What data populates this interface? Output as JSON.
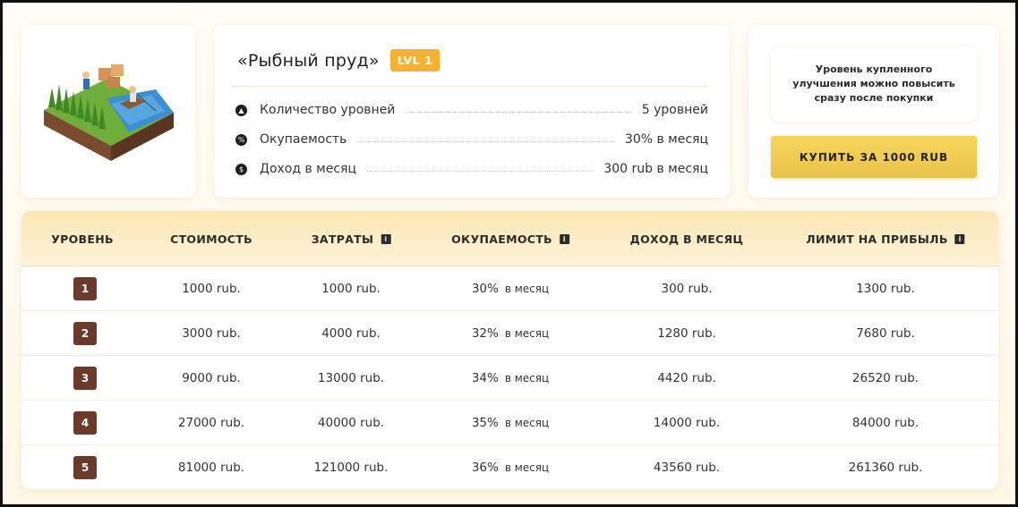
{
  "product": {
    "title": "«Рыбный пруд»",
    "level_badge": "LVL 1",
    "image_icon": "fishing-pond-isometric-icon"
  },
  "stats": [
    {
      "icon": "arrow-up-icon",
      "label": "Количество уровней",
      "value": "5 уровней"
    },
    {
      "icon": "percent-icon",
      "label": "Окупаемость",
      "value": "30% в месяц"
    },
    {
      "icon": "dollar-icon",
      "label": "Доход в месяц",
      "value": "300 rub в месяц"
    }
  ],
  "purchase": {
    "note": "Уровень купленного улучшения можно повысить сразу после покупки",
    "buy_label": "КУПИТЬ ЗА 1000 RUB"
  },
  "table": {
    "headers": [
      "УРОВЕНЬ",
      "СТОИМОСТЬ",
      "ЗАТРАТЫ",
      "ОКУПАЕМОСТЬ",
      "ДОХОД В МЕСЯЦ",
      "ЛИМИТ НА ПРИБЫЛЬ"
    ],
    "rows": [
      {
        "level": "1",
        "cost": "1000 rub.",
        "expenses": "1000 rub.",
        "payback": "30%",
        "payback_suffix": "в месяц",
        "income": "300 rub.",
        "limit": "1300 rub."
      },
      {
        "level": "2",
        "cost": "3000 rub.",
        "expenses": "4000 rub.",
        "payback": "32%",
        "payback_suffix": "в месяц",
        "income": "1280 rub.",
        "limit": "7680 rub."
      },
      {
        "level": "3",
        "cost": "9000 rub.",
        "expenses": "13000 rub.",
        "payback": "34%",
        "payback_suffix": "в месяц",
        "income": "4420 rub.",
        "limit": "26520 rub."
      },
      {
        "level": "4",
        "cost": "27000 rub.",
        "expenses": "40000 rub.",
        "payback": "35%",
        "payback_suffix": "в месяц",
        "income": "14000 rub.",
        "limit": "84000 rub."
      },
      {
        "level": "5",
        "cost": "81000 rub.",
        "expenses": "121000 rub.",
        "payback": "36%",
        "payback_suffix": "в месяц",
        "income": "43560 rub.",
        "limit": "261360 rub."
      }
    ]
  },
  "colors": {
    "accent": "#f5b133",
    "button": "#f0cf53",
    "level_square": "#6b3a2a",
    "header_bg": "#fbe7b5"
  }
}
